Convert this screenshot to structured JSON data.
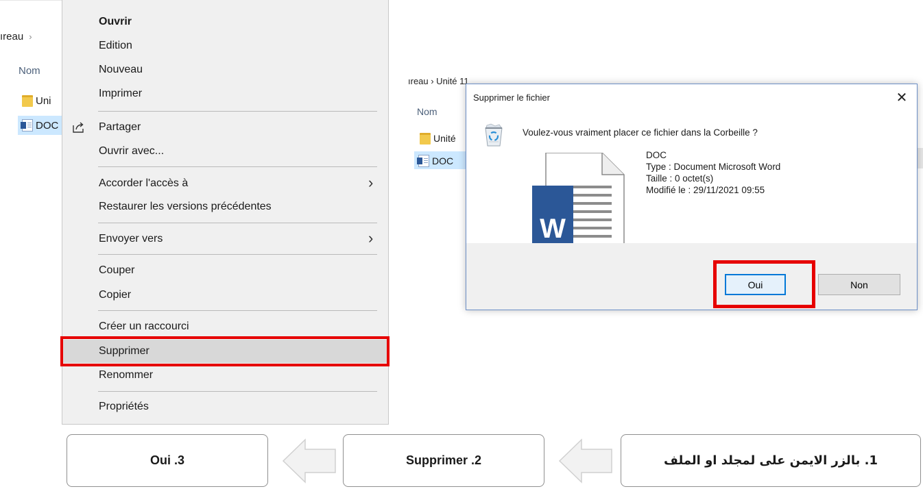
{
  "left_explorer": {
    "breadcrumb": "ıreau",
    "breadcrumb_chevron": "›",
    "column_header": "Nom",
    "rows": [
      {
        "label": "Uni",
        "icon": "folder-icon"
      },
      {
        "label": "DOC",
        "icon": "word-document-icon"
      }
    ]
  },
  "context_menu": {
    "items": [
      {
        "label": "Ouvrir",
        "bold": true
      },
      {
        "label": "Edition"
      },
      {
        "label": "Nouveau"
      },
      {
        "label": "Imprimer"
      },
      {
        "label": "Partager",
        "icon": "share-icon"
      },
      {
        "label": "Ouvrir avec..."
      },
      {
        "label": "Accorder l'accès à",
        "submenu": true
      },
      {
        "label": "Restaurer les versions précédentes"
      },
      {
        "label": "Envoyer vers",
        "submenu": true
      },
      {
        "label": "Couper"
      },
      {
        "label": "Copier"
      },
      {
        "label": "Créer un raccourci"
      },
      {
        "label": "Supprimer",
        "highlighted": true
      },
      {
        "label": "Renommer"
      },
      {
        "label": "Propriétés"
      }
    ],
    "submenu_arrow": "›"
  },
  "right_explorer": {
    "breadcrumb": "ıreau  ›  Unité 11",
    "column_header": "Nom",
    "rows": [
      {
        "label": "Unité",
        "icon": "folder-icon"
      },
      {
        "label": "DOC",
        "icon": "word-document-icon"
      }
    ]
  },
  "dialog": {
    "title": "Supprimer le fichier",
    "close_glyph": "✕",
    "question": "Voulez-vous vraiment placer ce fichier dans la Corbeille ?",
    "file_name": "DOC",
    "file_type": "Type : Document Microsoft Word",
    "file_size": "Taille : 0 octet(s)",
    "file_modified": "Modifié le : 29/11/2021 09:55",
    "word_letter": "W",
    "yes_button": "Oui",
    "no_button": "Non"
  },
  "steps": {
    "step1": "1. بالزر الايمن على لمجلد او الملف",
    "step2": "Supprimer .2",
    "step3": "Oui .3"
  },
  "colors": {
    "highlight_box": "#e60000",
    "selection": "#cce8ff",
    "word_blue": "#2b5797",
    "accent": "#0078d7"
  }
}
